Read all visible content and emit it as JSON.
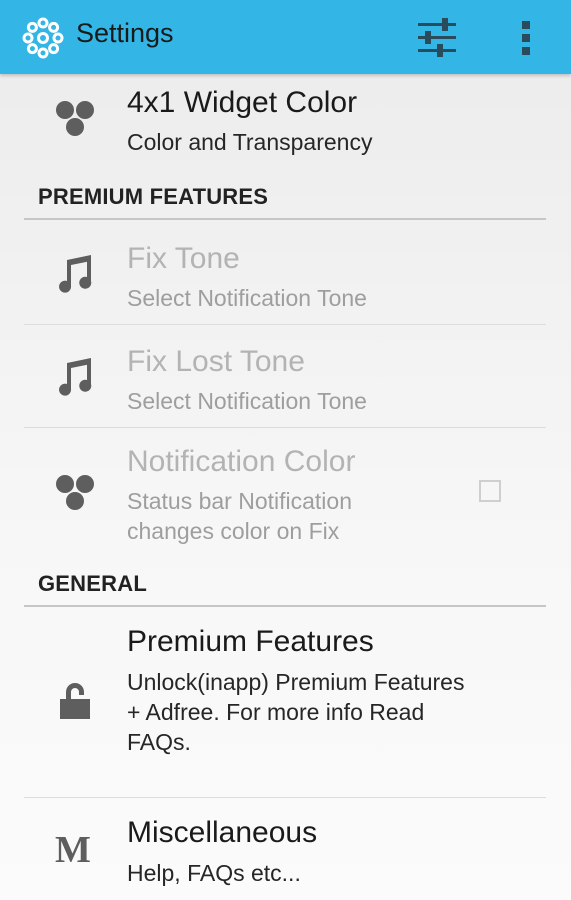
{
  "action_bar": {
    "title": "Settings",
    "background": "#33b5e5",
    "icons": [
      "gear-flower-icon",
      "sliders-icon",
      "overflow-menu-icon"
    ]
  },
  "prefs": {
    "widget_color": {
      "title": "4x1 Widget Color",
      "summary": "Color and Transparency",
      "icon": "color-dots-icon"
    },
    "premium_header": "PREMIUM FEATURES",
    "fix_tone": {
      "title": "Fix Tone",
      "summary": "Select Notification Tone",
      "icon": "music-note-icon",
      "enabled": false
    },
    "fix_lost_tone": {
      "title": "Fix Lost Tone",
      "summary": "Select Notification Tone",
      "icon": "music-note-icon",
      "enabled": false
    },
    "notification_color": {
      "title": "Notification Color",
      "summary_line1": "Status bar Notification",
      "summary_line2": "changes color on Fix",
      "icon": "color-dots-icon",
      "enabled": false,
      "checked": false
    },
    "general_header": "GENERAL",
    "premium_features": {
      "title": "Premium Features",
      "summary_line1": "Unlock(inapp) Premium Features",
      "summary_line2": "+ Adfree. For more info Read",
      "summary_line3": "FAQs.",
      "icon": "lock-icon"
    },
    "miscellaneous": {
      "title": "Miscellaneous",
      "summary": "Help, FAQs etc...",
      "icon_text": "M",
      "icon": "letter-m-icon"
    }
  }
}
